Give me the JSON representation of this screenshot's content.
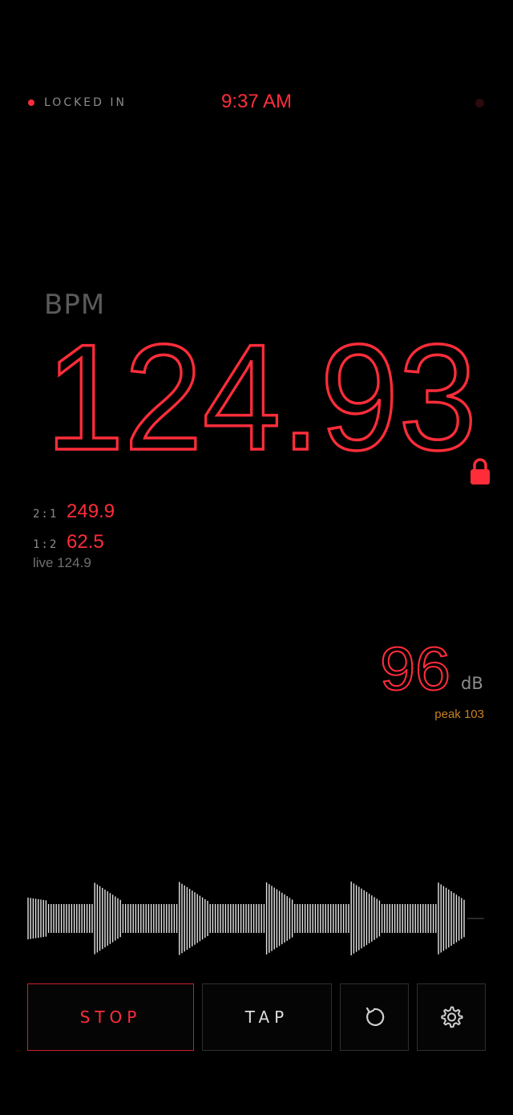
{
  "status": {
    "indicator_label": "LOCKED IN",
    "time": "9:37 AM"
  },
  "bpm": {
    "label": "BPM",
    "value": "124.93",
    "locked": true,
    "double_ratio_label": "2:1",
    "double_value": "249.9",
    "half_ratio_label": "1:2",
    "half_value": "62.5",
    "live_text": "live 124.9"
  },
  "level": {
    "value": "96",
    "unit": "dB",
    "peak_text": "peak 103"
  },
  "controls": {
    "stop_label": "STOP",
    "tap_label": "TAP",
    "reset_icon": "reset-icon",
    "settings_icon": "gear-icon"
  },
  "colors": {
    "accent": "#ff2d3a",
    "muted": "#8c8c8c",
    "peak": "#c9801f",
    "background": "#000000"
  }
}
